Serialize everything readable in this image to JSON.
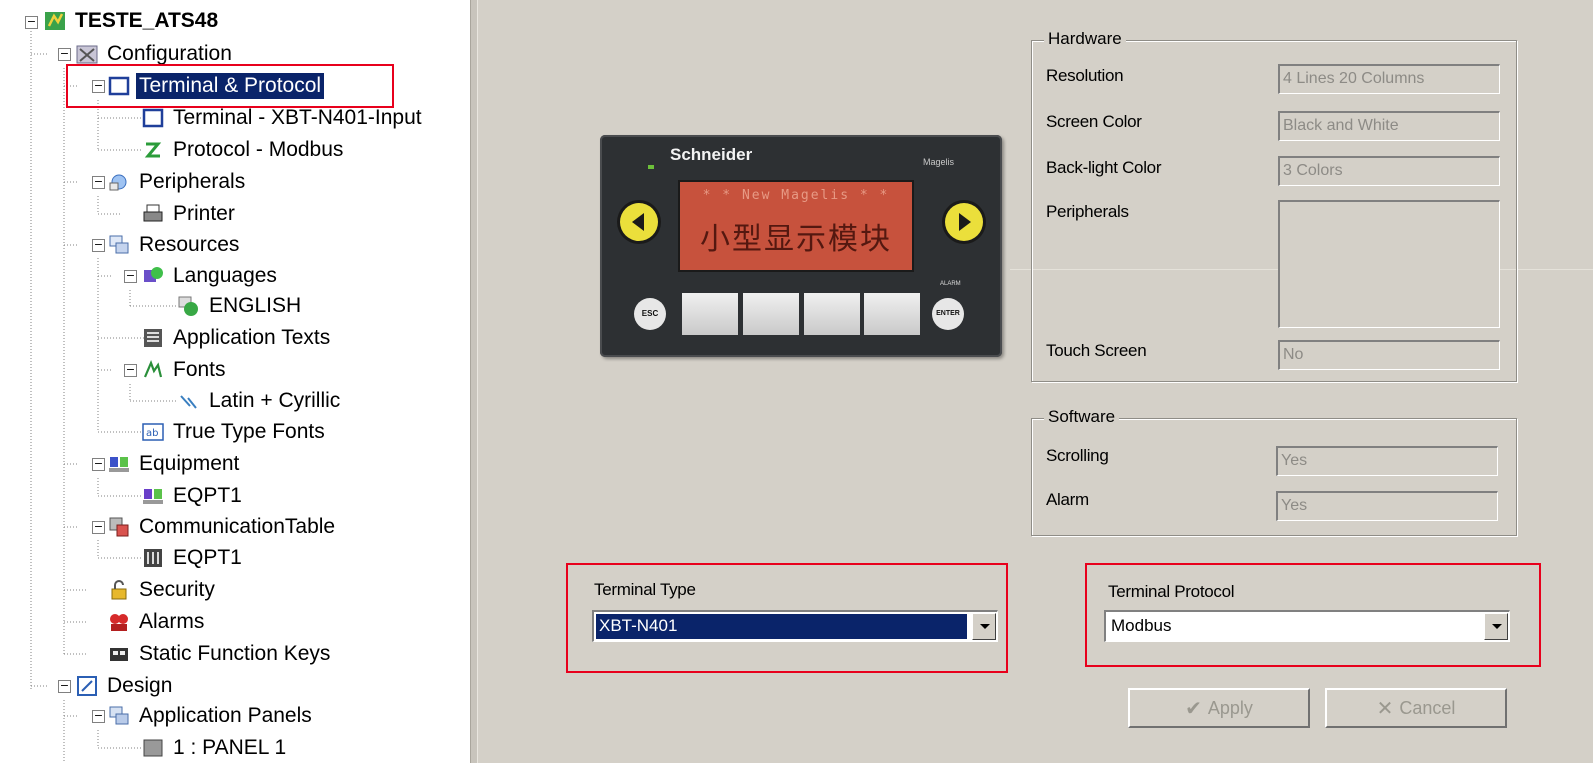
{
  "tree": {
    "nodes": [
      {
        "label": "TESTE_ATS48",
        "icon": "project-icon"
      },
      {
        "label": "Configuration",
        "icon": "configuration-icon"
      },
      {
        "label": "Terminal & Protocol",
        "icon": "terminal-protocol-icon"
      },
      {
        "label": "Terminal - XBT-N401-Input",
        "icon": "terminal-icon"
      },
      {
        "label": "Protocol - Modbus",
        "icon": "protocol-icon"
      },
      {
        "label": "Peripherals",
        "icon": "peripherals-icon"
      },
      {
        "label": "Printer",
        "icon": "printer-icon"
      },
      {
        "label": "Resources",
        "icon": "resources-icon"
      },
      {
        "label": "Languages",
        "icon": "languages-icon"
      },
      {
        "label": "ENGLISH",
        "icon": "language-icon"
      },
      {
        "label": "Application Texts",
        "icon": "application-texts-icon"
      },
      {
        "label": "Fonts",
        "icon": "fonts-icon"
      },
      {
        "label": "Latin + Cyrillic",
        "icon": "font-icon"
      },
      {
        "label": "True Type Fonts",
        "icon": "true-type-fonts-icon"
      },
      {
        "label": "Equipment",
        "icon": "equipment-icon"
      },
      {
        "label": "EQPT1",
        "icon": "equipment-item-icon"
      },
      {
        "label": "CommunicationTable",
        "icon": "communication-table-icon"
      },
      {
        "label": "EQPT1",
        "icon": "communication-table-item-icon"
      },
      {
        "label": "Security",
        "icon": "security-icon"
      },
      {
        "label": "Alarms",
        "icon": "alarms-icon"
      },
      {
        "label": "Static Function Keys",
        "icon": "static-function-keys-icon"
      },
      {
        "label": "Design",
        "icon": "design-icon"
      },
      {
        "label": "Application Panels",
        "icon": "application-panels-icon"
      },
      {
        "label": "1 : PANEL 1",
        "icon": "panel-icon"
      }
    ],
    "selected": "Terminal & Protocol"
  },
  "device": {
    "brand": "Schneider",
    "model": "Magelis",
    "screen_line1": "* * New Magelis * *",
    "screen_line2": "小型显示模块",
    "esc_label": "ESC",
    "enter_label": "ENTER",
    "alarm_label": "ALARM"
  },
  "hardware": {
    "title": "Hardware",
    "resolution_label": "Resolution",
    "resolution_value": "4 Lines 20 Columns",
    "screen_color_label": "Screen Color",
    "screen_color_value": "Black and White",
    "backlight_label": "Back-light Color",
    "backlight_value": "3 Colors",
    "peripherals_label": "Peripherals",
    "peripherals_value": "",
    "touch_label": "Touch Screen",
    "touch_value": "No"
  },
  "software": {
    "title": "Software",
    "scrolling_label": "Scrolling",
    "scrolling_value": "Yes",
    "alarm_label": "Alarm",
    "alarm_value": "Yes"
  },
  "terminal_type": {
    "label": "Terminal Type",
    "value": "XBT-N401"
  },
  "terminal_protocol": {
    "label": "Terminal Protocol",
    "value": "Modbus"
  },
  "buttons": {
    "apply": "Apply",
    "cancel": "Cancel"
  },
  "colors": {
    "highlight": "#e8001c",
    "selection": "#0a246a",
    "panel": "#d4d0c8"
  }
}
